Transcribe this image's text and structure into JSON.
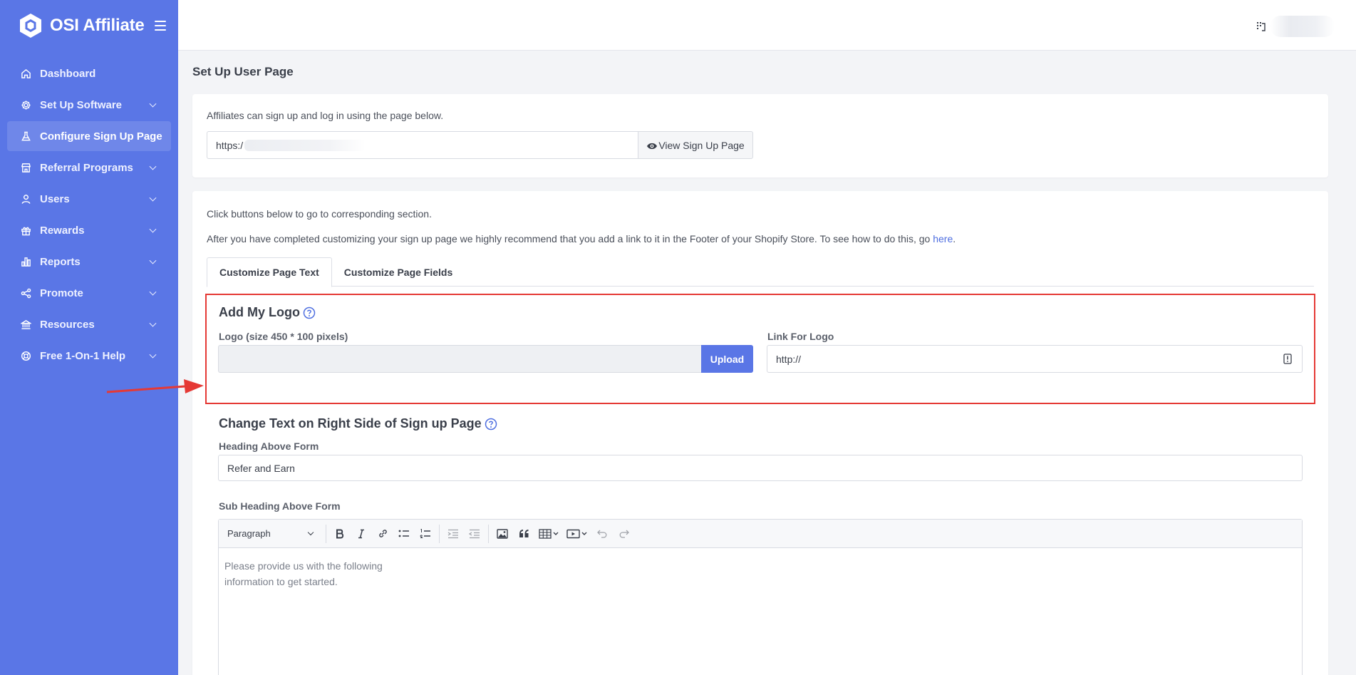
{
  "app": {
    "name": "OSI Affiliate"
  },
  "sidebar": {
    "items": [
      {
        "label": "Dashboard",
        "icon": "home-icon",
        "has_submenu": false,
        "active": false
      },
      {
        "label": "Set Up Software",
        "icon": "gear-icon",
        "has_submenu": true,
        "active": false
      },
      {
        "label": "Configure Sign Up Page",
        "icon": "flask-icon",
        "has_submenu": false,
        "active": true
      },
      {
        "label": "Referral Programs",
        "icon": "store-icon",
        "has_submenu": true,
        "active": false
      },
      {
        "label": "Users",
        "icon": "user-icon",
        "has_submenu": true,
        "active": false
      },
      {
        "label": "Rewards",
        "icon": "gift-icon",
        "has_submenu": true,
        "active": false
      },
      {
        "label": "Reports",
        "icon": "bar-chart-icon",
        "has_submenu": true,
        "active": false
      },
      {
        "label": "Promote",
        "icon": "share-icon",
        "has_submenu": true,
        "active": false
      },
      {
        "label": "Resources",
        "icon": "bank-icon",
        "has_submenu": true,
        "active": false
      },
      {
        "label": "Free 1-On-1 Help",
        "icon": "lifebuoy-icon",
        "has_submenu": true,
        "active": false
      }
    ]
  },
  "page": {
    "title": "Set Up User Page",
    "signup_card": {
      "description": "Affiliates can sign up and log in using the page below.",
      "url_value": "https:/",
      "view_button": "View Sign Up Page"
    },
    "intro": {
      "line1": "Click buttons below to go to corresponding section.",
      "line2": "After you have completed customizing your sign up page we highly recommend that you add a link to it in the Footer of your Shopify Store. To see how to do this, go ",
      "link_text": "here",
      "line2_end": "."
    },
    "tabs": [
      {
        "label": "Customize Page Text",
        "active": true
      },
      {
        "label": "Customize Page Fields",
        "active": false
      }
    ],
    "logo_section": {
      "title": "Add My Logo",
      "logo_label": "Logo (size 450 * 100 pixels)",
      "logo_value": "",
      "upload_button": "Upload",
      "link_label": "Link For Logo",
      "link_value": "http://"
    },
    "text_section": {
      "title": "Change Text on Right Side of Sign up Page",
      "heading_label": "Heading Above Form",
      "heading_value": "Refer and Earn",
      "subheading_label": "Sub Heading Above Form",
      "editor": {
        "format_select": "Paragraph",
        "content_line1": "Please provide us with the following",
        "content_line2": "information to get started."
      }
    }
  },
  "colors": {
    "sidebar_bg": "#5a76e6",
    "accent": "#5a76e6",
    "highlight_border": "#e53935",
    "link": "#4f6fe0"
  }
}
